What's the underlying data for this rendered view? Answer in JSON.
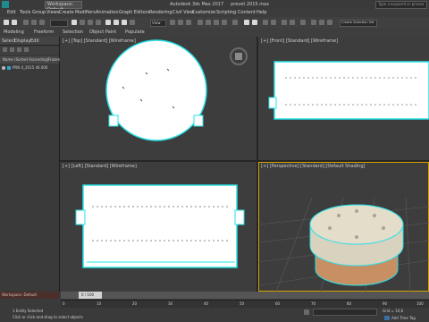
{
  "titlebar": {
    "workspace_label": "Workspace: Default",
    "title": "Autodesk 3ds Max 2017     prevet 2015.max",
    "search_placeholder": "Type a keyword or phrase"
  },
  "menu": [
    "Edit",
    "Tools",
    "Group",
    "Views",
    "Create",
    "Modifiers",
    "Animation",
    "Graph Editors",
    "Rendering",
    "Civil View",
    "Customize",
    "Scripting",
    "Content",
    "Help"
  ],
  "toolbar": {
    "view_dropdown": "View",
    "selection_set": "Create Selection Set"
  },
  "ribbon": {
    "items": [
      "Modeling",
      "Freeform",
      "Selection",
      "Object Paint",
      "Populate"
    ]
  },
  "scene_explorer": {
    "tabs": [
      "Select",
      "Display",
      "Edit"
    ],
    "header": "Name (Sorted Ascending)",
    "header_right": "Frozen",
    "items": [
      "PRN 4_2015 40.000"
    ]
  },
  "viewports": {
    "top_label": "[+] [Top] [Standard] [Wireframe]",
    "front_label": "[+] [Front] [Standard] [Wireframe]",
    "left_label": "[+] [Left] [Standard] [Wireframe]",
    "persp_label": "[+] [Perspective] [Standard] [Default Shading]"
  },
  "timeline": {
    "frame_label": "0 / 100",
    "ticks": [
      "0",
      "5",
      "10",
      "15",
      "20",
      "25",
      "30",
      "35",
      "40",
      "45",
      "50",
      "55",
      "60",
      "65",
      "70",
      "75",
      "80",
      "85",
      "90",
      "95",
      "100"
    ]
  },
  "status": {
    "workspace": "Workspace: Default",
    "selected": "1 Entity Selected",
    "prompt": "Click or click-and-drag to select objects",
    "grid": "Grid = 10,0",
    "add_time_tag": "Add Time Tag"
  },
  "colors": {
    "wireframe_white": "#ffffff",
    "selection_cyan": "#28e0e8",
    "viewport_bg": "#3d3d3d",
    "active_border": "#d3a200",
    "model_top": "#d9d2bf",
    "model_band": "#c89062",
    "timeline_accent": "#3a6ea5"
  }
}
